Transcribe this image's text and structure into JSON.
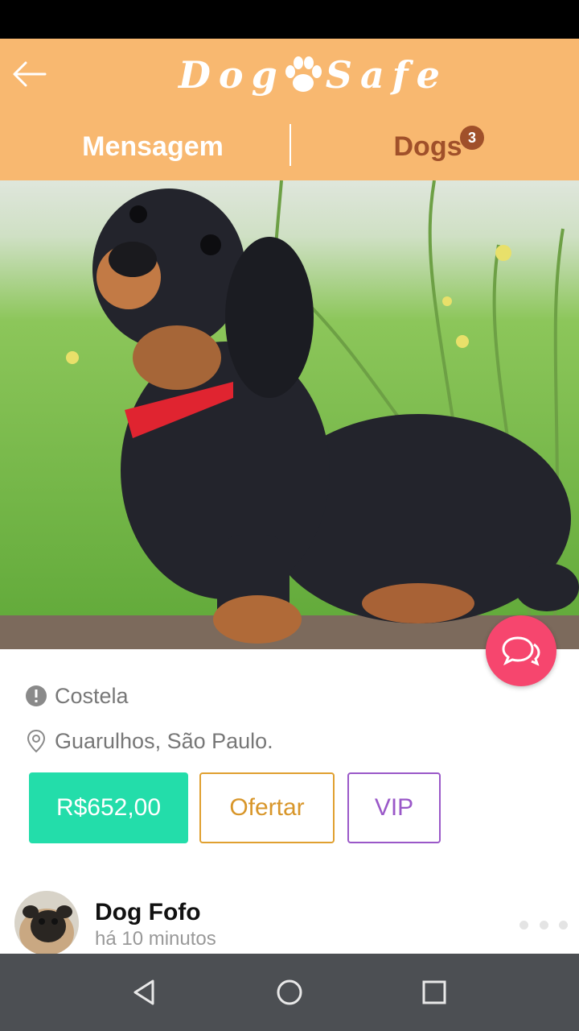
{
  "header": {
    "logo_text_left": "Dog",
    "logo_text_right": "Safe",
    "tabs": [
      {
        "label": "Mensagem"
      },
      {
        "label": "Dogs",
        "badge": "3"
      }
    ],
    "background_color": "#f8b870"
  },
  "icons": {
    "back": "back-arrow-icon",
    "logo": "paw-icon",
    "chat": "chat-bubbles-icon",
    "info": "exclamation-circle-icon",
    "location": "map-pin-icon",
    "more": "more-dots-icon"
  },
  "listing": {
    "breed": "Costela",
    "location": "Guarulhos, São Paulo.",
    "price_label": "R$652,00",
    "offer_label": "Ofertar",
    "vip_label": "VIP"
  },
  "post": {
    "author": "Dog Fofo",
    "time": "há 10 minutos"
  },
  "colors": {
    "price_button": "#23ddaa",
    "offer_border": "#e0a030",
    "vip_border": "#9a58c8",
    "chat_fab": "#f6466e",
    "dogs_tab": "#a0502a"
  }
}
